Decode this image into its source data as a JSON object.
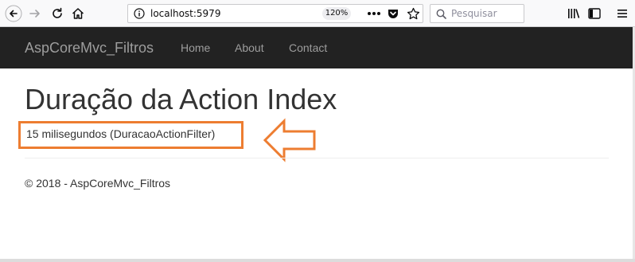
{
  "browser": {
    "url": "localhost:5979",
    "zoom": "120%",
    "search_placeholder": "Pesquisar"
  },
  "navbar": {
    "brand": "AspCoreMvc_Filtros",
    "links": [
      "Home",
      "About",
      "Contact"
    ]
  },
  "main": {
    "title": "Duração da Action Index",
    "duration_text": "15 milisegundos (DuracaoActionFilter)"
  },
  "footer": {
    "text": "© 2018 - AspCoreMvc_Filtros"
  },
  "colors": {
    "navbar_bg": "#222222",
    "nav_text": "#9d9d9d",
    "highlight": "#ed7d31"
  },
  "icons": [
    "back-icon",
    "forward-icon",
    "reload-icon",
    "home-icon",
    "info-icon",
    "more-icon",
    "pocket-icon",
    "bookmark-star-icon",
    "search-icon",
    "library-icon",
    "sidebar-icon",
    "menu-icon"
  ]
}
